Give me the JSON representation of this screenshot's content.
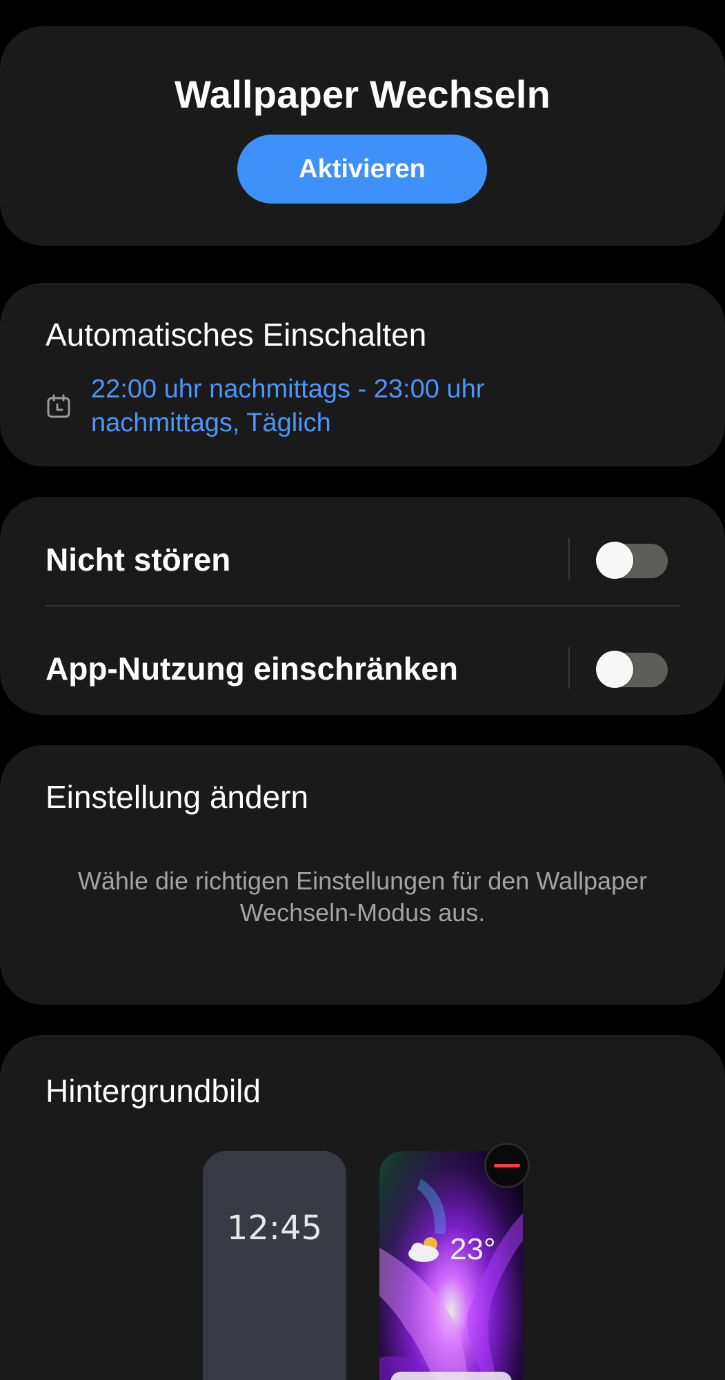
{
  "mode": {
    "title": "Wallpaper Wechseln",
    "activate_label": "Aktivieren",
    "accent_color": "#3e91fb"
  },
  "schedule": {
    "title": "Automatisches Einschalten",
    "icon": "calendar-icon",
    "text": "22:00 uhr nachmittags - 23:00 uhr nachmittags, Täglich"
  },
  "toggles": [
    {
      "label": "Nicht stören",
      "on": false
    },
    {
      "label": "App-Nutzung einschränken",
      "on": false
    }
  ],
  "settings_info": {
    "title": "Einstellung ändern",
    "description": "Wähle die richtigen Einstellungen für den Wallpaper Wechseln-Modus aus."
  },
  "wallpaper": {
    "title": "Hintergrundbild",
    "lock_preview_time": "12:45",
    "home_preview_temp": "23°",
    "weather_icon": "partly-cloudy-icon",
    "remove_icon": "minus-icon",
    "remove_color": "#ff3b4a"
  }
}
